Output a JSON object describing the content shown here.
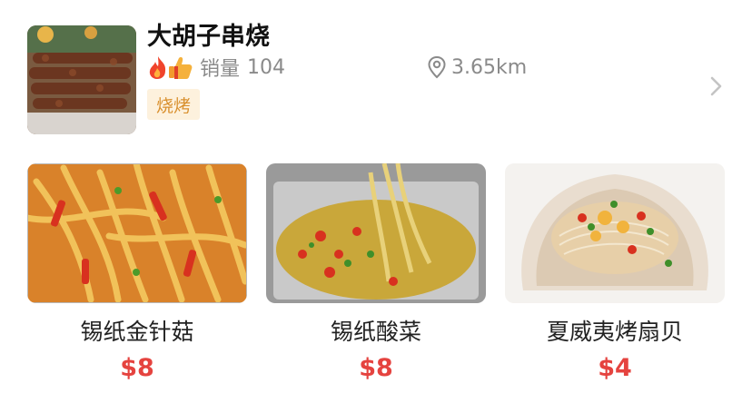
{
  "store": {
    "name": "大胡子串烧",
    "sales_label": "销量",
    "sales_count": "104",
    "distance": "3.65km",
    "category_tag": "烧烤"
  },
  "dishes": [
    {
      "name": "锡纸金针菇",
      "price": "$8"
    },
    {
      "name": "锡纸酸菜",
      "price": "$8"
    },
    {
      "name": "夏威夷烤扇贝",
      "price": "$4"
    }
  ],
  "colors": {
    "price": "#e5433f",
    "tag_bg": "#fdf1dd",
    "tag_text": "#d9902e",
    "meta_text": "#8a8a8a"
  },
  "icons": [
    "fire-thumbs-up-icon",
    "location-pin-icon",
    "chevron-right-icon"
  ]
}
